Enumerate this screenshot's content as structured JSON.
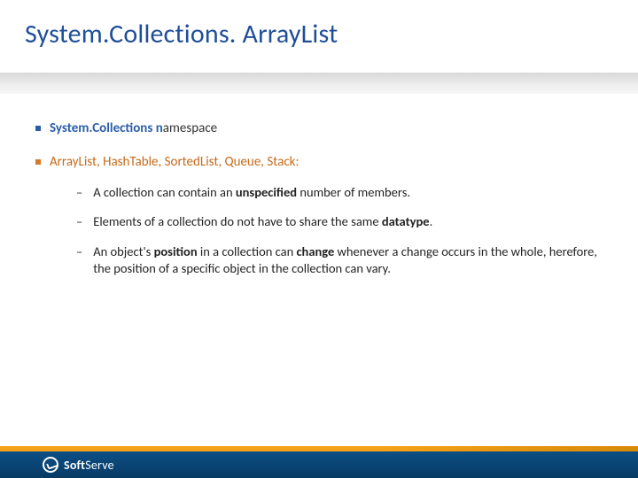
{
  "title": "System.Collections. ArrayList",
  "bullets": {
    "b1_strong": "System.Collections n",
    "b1_rest": "amespace",
    "b2": "ArrayList, HashTable, SortedList, Queue, Stack:"
  },
  "dashes": {
    "d1_pre": "A collection can contain an ",
    "d1_b1": "unspecified",
    "d1_post": " number of members.",
    "d2_pre": "Elements of a collection do not have to share the same ",
    "d2_b1": "datatype",
    "d2_post": ".",
    "d3_pre": "An object's ",
    "d3_b1": "position",
    "d3_mid": " in a collection can ",
    "d3_b2": "change",
    "d3_post": " whenever a change occurs in the whole, herefore, the position of a specific object in the collection can vary."
  },
  "footer": {
    "brand_a": "Soft",
    "brand_b": "Serve"
  },
  "glyphs": {
    "dash": "–"
  }
}
